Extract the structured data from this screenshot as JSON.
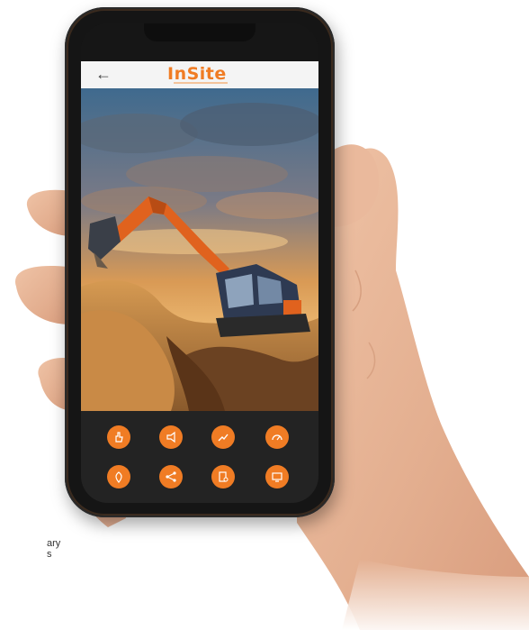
{
  "app": {
    "title": "InSite",
    "back_icon": "arrow-left-icon"
  },
  "colors": {
    "accent": "#f07c24",
    "dock_bg": "#232323",
    "appbar_bg": "#f4f4f4"
  },
  "dock": {
    "buttons": [
      {
        "icon": "hand-point-icon"
      },
      {
        "icon": "megaphone-icon"
      },
      {
        "icon": "trend-line-icon"
      },
      {
        "icon": "dashboard-icon"
      },
      {
        "icon": "location-pin-icon"
      },
      {
        "icon": "share-network-icon"
      },
      {
        "icon": "document-gear-icon"
      },
      {
        "icon": "monitor-icon"
      }
    ]
  },
  "caption": {
    "line1": "ary",
    "line2": "s"
  }
}
